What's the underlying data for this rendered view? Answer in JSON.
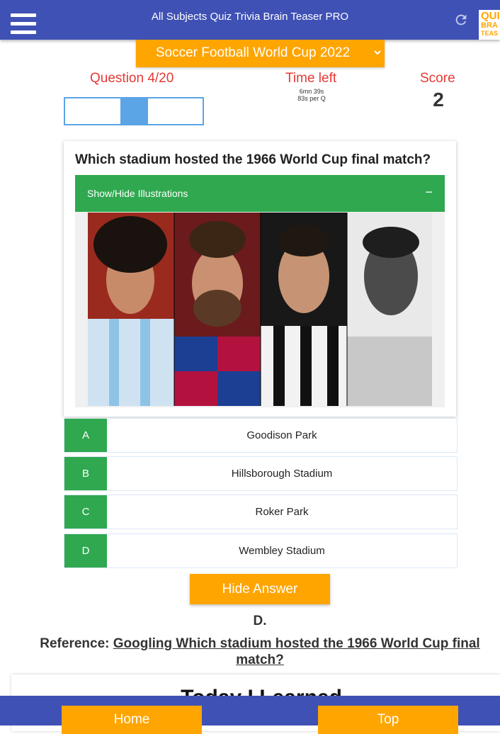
{
  "header": {
    "title": "All Subjects Quiz Trivia Brain Teaser PRO",
    "logo_lines": [
      "QUI",
      "BRA",
      "TEAS"
    ],
    "menu_icon": "hamburger-menu-icon",
    "refresh_icon": "refresh-icon"
  },
  "category": {
    "selected": "Soccer Football World Cup 2022"
  },
  "stats": {
    "question_label": "Question 4/20",
    "time_label": "Time left",
    "time_remaining": "6mn 39s",
    "time_per_question": "83s per Q",
    "score_label": "Score",
    "score_value": "2",
    "progress_fraction": 0.2
  },
  "question": {
    "text": "Which stadium hosted the 1966 World Cup final match?",
    "illustrations_toggle": "Show/Hide Illustrations",
    "toggle_symbol": "−"
  },
  "answers": [
    {
      "letter": "A",
      "text": "Goodison Park"
    },
    {
      "letter": "B",
      "text": "Hillsborough Stadium"
    },
    {
      "letter": "C",
      "text": "Roker Park"
    },
    {
      "letter": "D",
      "text": "Wembley Stadium"
    }
  ],
  "hide_answer_label": "Hide Answer",
  "correct_answer": "D.",
  "reference": {
    "label": "Reference:",
    "link_text": "Googling Which stadium hosted the 1966 World Cup final match?"
  },
  "learned_title": "Today I Learned",
  "bottom_nav": {
    "home_label": "Home",
    "top_label": "Top"
  },
  "colors": {
    "primary": "#3f51b5",
    "accent": "#ffa500",
    "answer_green": "#2fa84f",
    "stat_red": "#e53935",
    "progress_blue": "#5ba4e5"
  }
}
